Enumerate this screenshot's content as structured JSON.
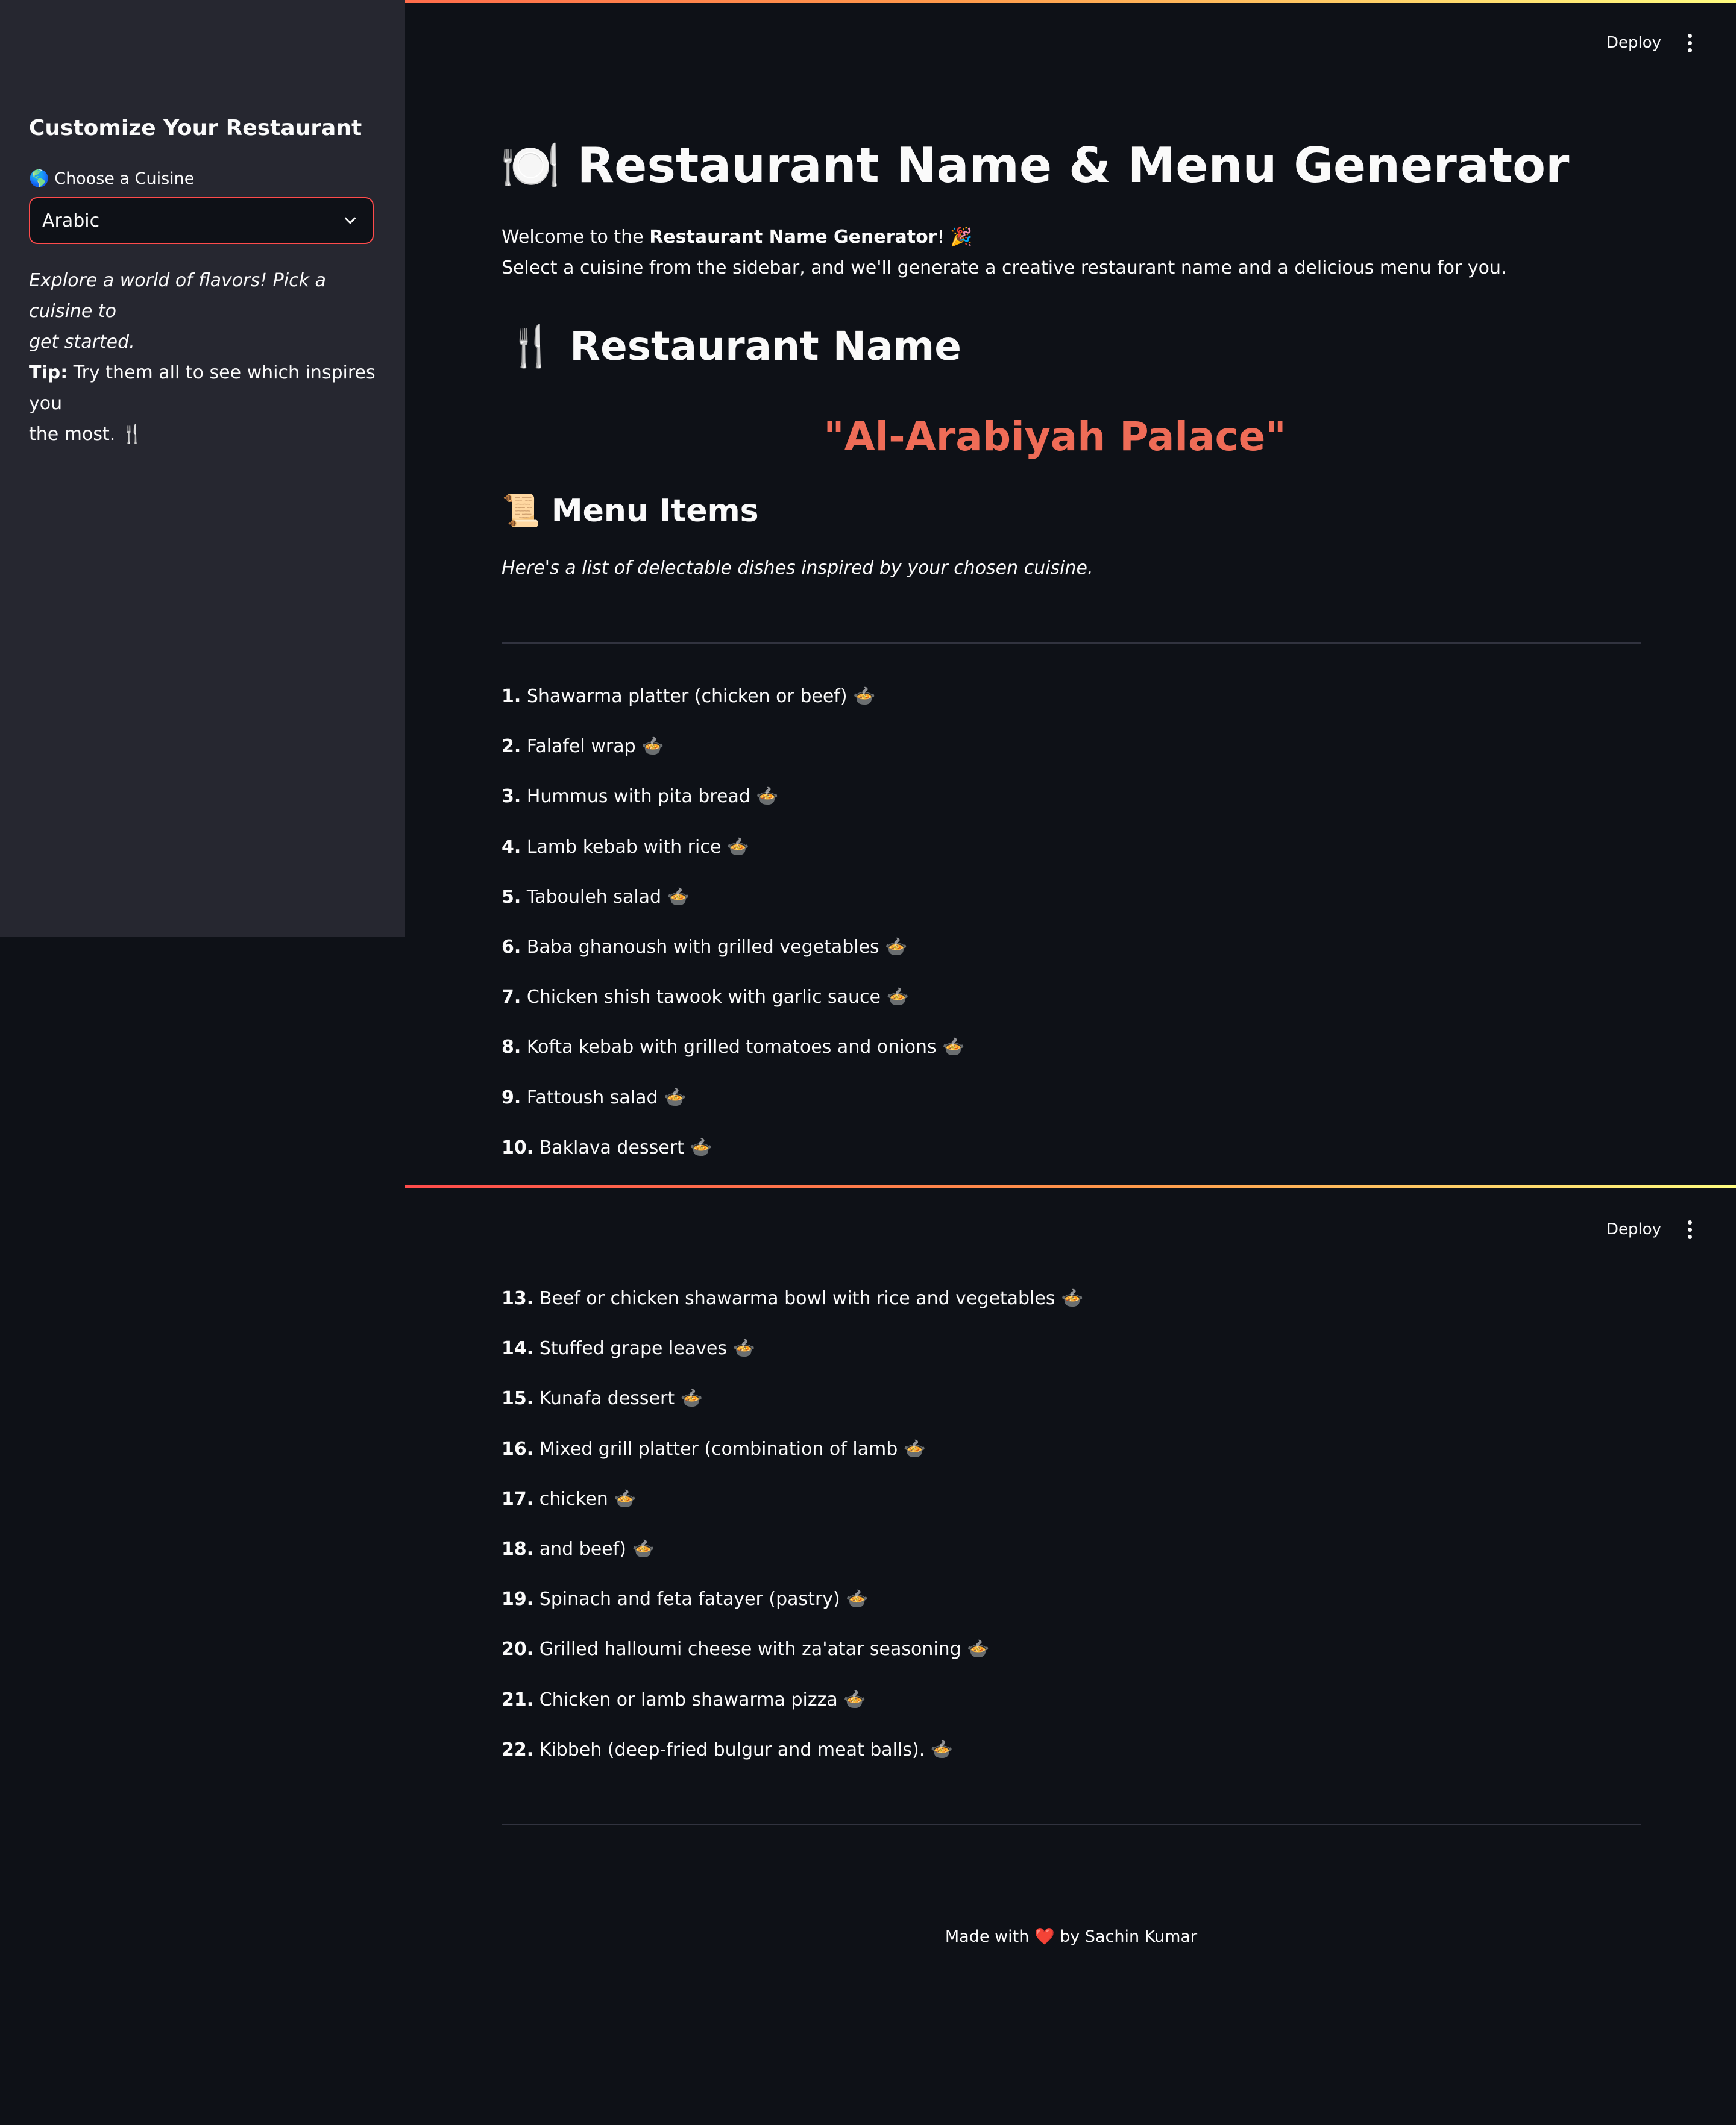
{
  "header": {
    "deploy_label": "Deploy",
    "menu_icon": "kebab-menu-icon"
  },
  "sidebar": {
    "title": "Customize Your Restaurant",
    "select_icon": "🌎",
    "select_label": "Choose a Cuisine",
    "select_value": "Arabic",
    "intro_italic_1": "Explore a world of flavors! Pick a cuisine to",
    "intro_italic_2": "get started.",
    "tip_label": "Tip:",
    "tip_text_1": " Try them all to see which inspires you",
    "tip_text_2": "the most. 🍴"
  },
  "main": {
    "title_icon": "🍽️",
    "title": "Restaurant Name & Menu Generator",
    "welcome_prefix": "Welcome to the ",
    "welcome_bold": "Restaurant Name Generator",
    "welcome_suffix": "! 🎉",
    "instructions": "Select a cuisine from the sidebar, and we'll generate a creative restaurant name and a delicious menu for you.",
    "name_heading_icon": "🍴",
    "name_heading": "Restaurant Name",
    "restaurant_name": "\"Al-Arabiyah Palace\"",
    "menu_heading_icon": "📜",
    "menu_heading": "Menu Items",
    "menu_caption": "Here's a list of delectable dishes inspired by your chosen cuisine.",
    "menu_items_top": [
      {
        "num": "1.",
        "text": "Shawarma platter (chicken or beef)"
      },
      {
        "num": "2.",
        "text": "Falafel wrap"
      },
      {
        "num": "3.",
        "text": "Hummus with pita bread"
      },
      {
        "num": "4.",
        "text": "Lamb kebab with rice"
      },
      {
        "num": "5.",
        "text": "Tabouleh salad"
      },
      {
        "num": "6.",
        "text": "Baba ghanoush with grilled vegetables"
      },
      {
        "num": "7.",
        "text": "Chicken shish tawook with garlic sauce"
      },
      {
        "num": "8.",
        "text": "Kofta kebab with grilled tomatoes and onions"
      },
      {
        "num": "9.",
        "text": "Fattoush salad"
      },
      {
        "num": "10.",
        "text": "Baklava dessert"
      }
    ],
    "menu_items_bottom": [
      {
        "num": "13.",
        "text": "Beef or chicken shawarma bowl with rice and vegetables"
      },
      {
        "num": "14.",
        "text": "Stuffed grape leaves"
      },
      {
        "num": "15.",
        "text": "Kunafa dessert"
      },
      {
        "num": "16.",
        "text": "Mixed grill platter (combination of lamb"
      },
      {
        "num": "17.",
        "text": "chicken"
      },
      {
        "num": "18.",
        "text": "and beef)"
      },
      {
        "num": "19.",
        "text": "Spinach and feta fatayer (pastry)"
      },
      {
        "num": "20.",
        "text": "Grilled halloumi cheese with za'atar seasoning"
      },
      {
        "num": "21.",
        "text": "Chicken or lamb shawarma pizza"
      },
      {
        "num": "22.",
        "text": "Kibbeh (deep-fried bulgur and meat balls)."
      }
    ],
    "item_icon": "🍲"
  },
  "footer": {
    "prefix": "Made with ",
    "heart": "❤️",
    "suffix": " by Sachin Kumar"
  }
}
